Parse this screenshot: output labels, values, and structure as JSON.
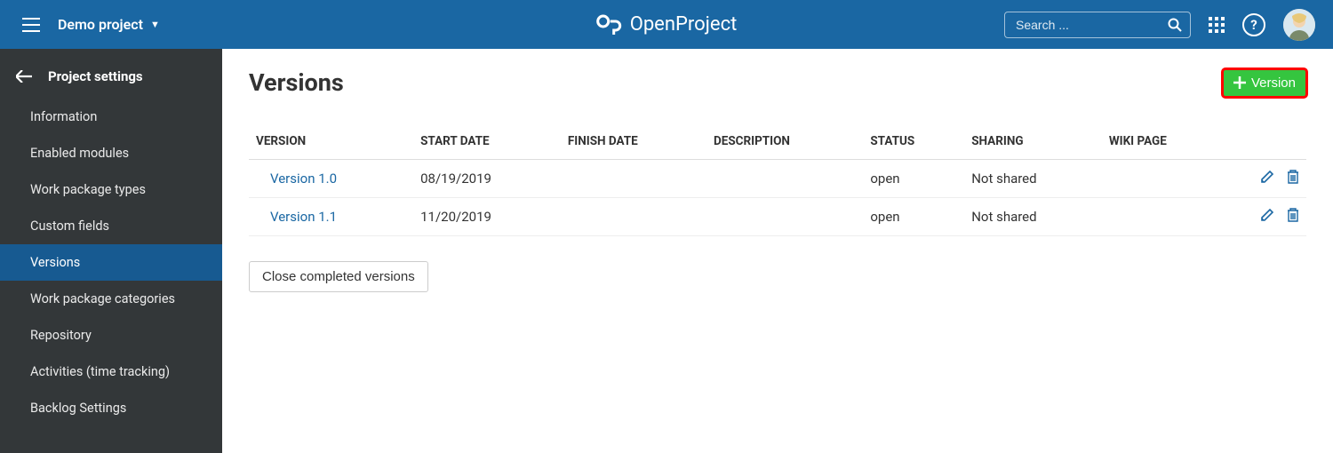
{
  "topbar": {
    "project_name": "Demo project",
    "brand": "OpenProject",
    "search_placeholder": "Search ..."
  },
  "sidebar": {
    "header": "Project settings",
    "items": [
      {
        "label": "Information"
      },
      {
        "label": "Enabled modules"
      },
      {
        "label": "Work package types"
      },
      {
        "label": "Custom fields"
      },
      {
        "label": "Versions",
        "active": true
      },
      {
        "label": "Work package categories"
      },
      {
        "label": "Repository"
      },
      {
        "label": "Activities (time tracking)"
      },
      {
        "label": "Backlog Settings"
      }
    ]
  },
  "content": {
    "title": "Versions",
    "add_button_label": "Version",
    "close_button_label": "Close completed versions",
    "columns": [
      "VERSION",
      "START DATE",
      "FINISH DATE",
      "DESCRIPTION",
      "STATUS",
      "SHARING",
      "WIKI PAGE"
    ],
    "rows": [
      {
        "version": "Version 1.0",
        "start_date": "08/19/2019",
        "finish_date": "",
        "description": "",
        "status": "open",
        "sharing": "Not shared",
        "wiki_page": ""
      },
      {
        "version": "Version 1.1",
        "start_date": "11/20/2019",
        "finish_date": "",
        "description": "",
        "status": "open",
        "sharing": "Not shared",
        "wiki_page": ""
      }
    ]
  }
}
